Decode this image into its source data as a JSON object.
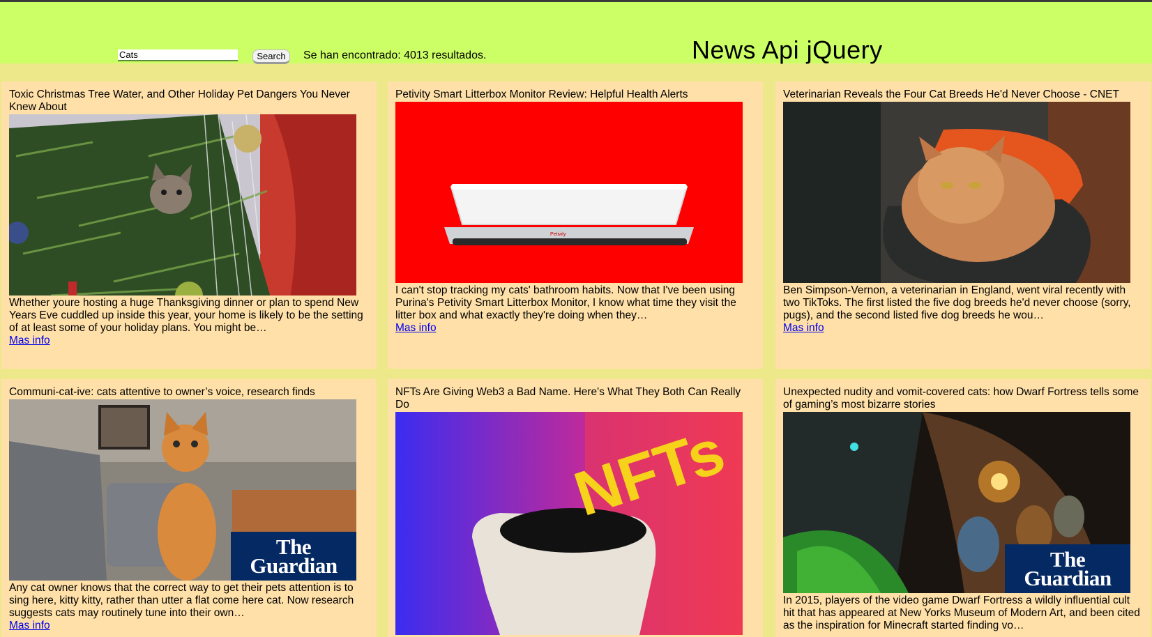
{
  "header": {
    "search_value": "Cats",
    "search_button": "Search",
    "results_text": "Se han encontrado: 4013 resultados.",
    "title": "News Api jQuery",
    "background": "#ccff66"
  },
  "colors": {
    "page_bg": "#ede88a",
    "card_bg": "#ffe0a8",
    "link": "#0000ee"
  },
  "cards": [
    {
      "title": "Toxic Christmas Tree Water, and Other Holiday Pet Dangers You Never Knew About",
      "image_alt": "christmas-tree-cat-image",
      "description": "Whether youre hosting a huge Thanksgiving dinner or plan to spend New Years Eve cuddled up inside this year, your home is likely to be the setting of at least some of your holiday plans. You might be…",
      "link": "Mas info"
    },
    {
      "title": "Petivity Smart Litterbox Monitor Review: Helpful Health Alerts",
      "image_alt": "litterbox-monitor-image",
      "description": "I can't stop tracking my cats' bathroom habits. Now that I've been using Purina's Petivity Smart Litterbox Monitor, I know what time they visit the litter box and what exactly they're doing when they…",
      "link": "Mas info",
      "brand": "Petivity"
    },
    {
      "title": "Veterinarian Reveals the Four Cat Breeds He'd Never Choose - CNET",
      "image_alt": "persian-cat-image",
      "description": "Ben Simpson-Vernon, a veterinarian in England, went viral recently with two TikToks. The first listed the five dog breeds he'd never choose (sorry, pugs), and the second listed five dog breeds he wou…",
      "link": "Mas info"
    },
    {
      "title": "Communi-cat-ive: cats attentive to owner’s voice, research finds",
      "image_alt": "standing-cat-image",
      "description": "Any cat owner knows that the correct way to get their pets attention is to sing here, kitty kitty, rather than utter a flat come here cat. Now research suggests cats may routinely tune into their own…",
      "link": "Mas info",
      "logo": "The Guardian"
    },
    {
      "title": "NFTs Are Giving Web3 a Bad Name. Here's What They Both Can Really Do",
      "image_alt": "nft-bust-image",
      "description": "",
      "link": "",
      "image_text": "NFTs"
    },
    {
      "title": "Unexpected nudity and vomit-covered cats: how Dwarf Fortress tells some of gaming’s most bizarre stories",
      "image_alt": "dwarf-fortress-image",
      "description": "In 2015, players of the video game Dwarf Fortress a wildly influential cult hit that has appeared at New Yorks Museum of Modern Art, and been cited as the inspiration for Minecraft started finding vo…",
      "link": "",
      "logo": "The Guardian"
    }
  ]
}
